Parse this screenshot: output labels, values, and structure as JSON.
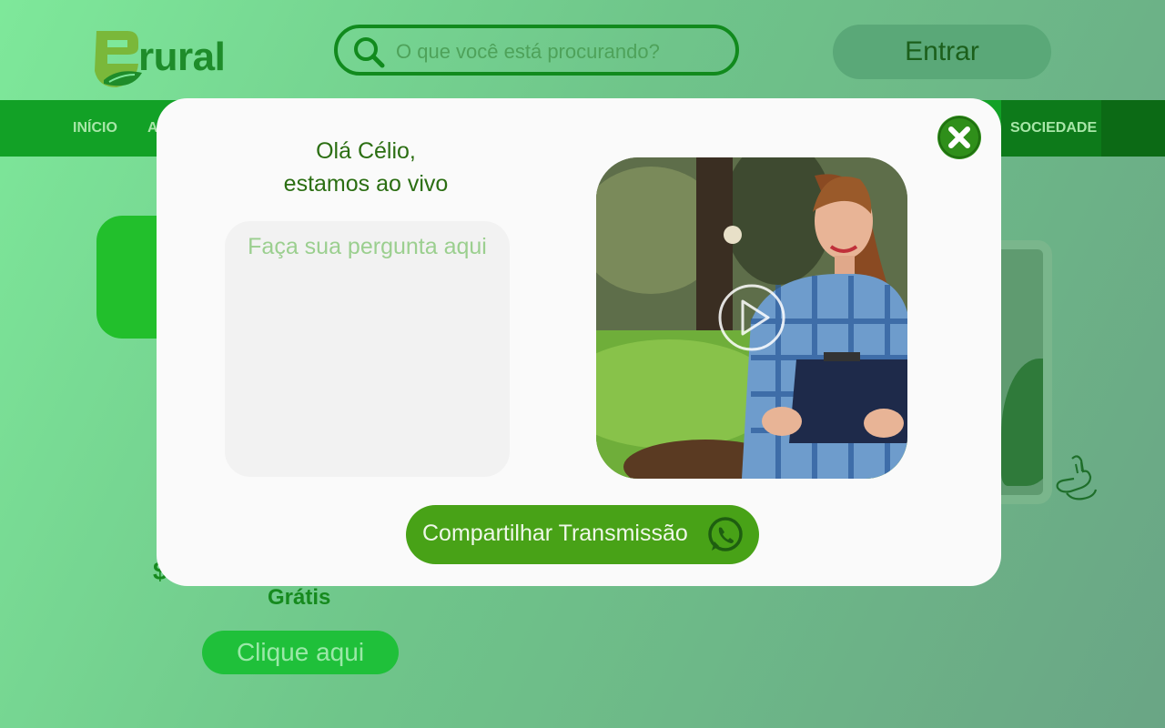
{
  "header": {
    "logo_text": "rural",
    "search_placeholder": "O que você está procurando?",
    "login_label": "Entrar"
  },
  "nav": {
    "items": [
      "INÍCIO",
      "A",
      "SOCIEDADE"
    ]
  },
  "background": {
    "free_label": "Grátis",
    "cta_label": "Clique aqui",
    "partial_symbol": "$"
  },
  "modal": {
    "greeting_line1": "Olá Célio,",
    "greeting_line2": "estamos ao vivo",
    "question_placeholder": "Faça sua pergunta aqui",
    "share_label": "Compartilhar Transmissão"
  },
  "colors": {
    "brand_green": "#1e8c2a",
    "nav_green": "#12a126",
    "button_green": "#48a217",
    "text_dark_green": "#2b6e12"
  },
  "icons": [
    "search-icon",
    "close-icon",
    "play-icon",
    "whatsapp-icon",
    "libras-hands-icon",
    "leaf-logo-icon"
  ]
}
